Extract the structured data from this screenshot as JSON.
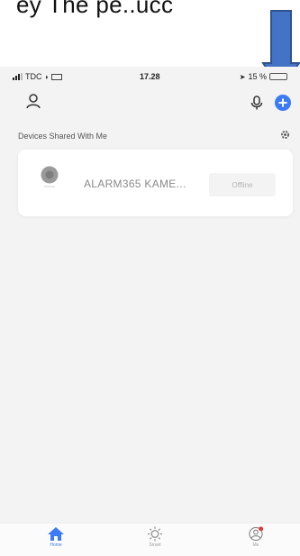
{
  "caption": {
    "text": "ey The pe..ucc"
  },
  "status_bar": {
    "carrier": "TDC",
    "time": "17.28",
    "right_text": "15 %"
  },
  "section": {
    "title": "Devices Shared With Me"
  },
  "devices": [
    {
      "name": "ALARM365 KAME...",
      "status": "Offline"
    }
  ],
  "tabs": [
    {
      "label": "Home",
      "icon": "home-icon",
      "active": true
    },
    {
      "label": "Smart",
      "icon": "sun-icon",
      "active": false
    },
    {
      "label": "Me",
      "icon": "profile-icon",
      "active": false
    }
  ],
  "colors": {
    "accent": "#3b7bf6",
    "arrow_fill": "#4472c4",
    "arrow_stroke": "#2f528f",
    "notification_dot": "#e53935",
    "screen_bg": "#f3f3f4"
  }
}
